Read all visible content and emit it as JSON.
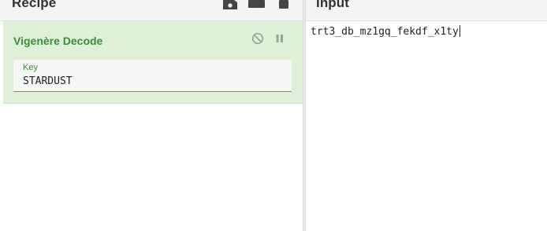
{
  "recipe": {
    "title": "Recipe",
    "toolbar_icons": [
      "save-icon",
      "folder-icon",
      "delete-icon"
    ],
    "operations": [
      {
        "name": "Vigenère Decode",
        "controls": [
          "disable-icon",
          "pause-icon"
        ],
        "fields": [
          {
            "label": "Key",
            "value": "STARDUST"
          }
        ]
      }
    ]
  },
  "input": {
    "title": "Input",
    "text": "trt3_db_mz1gq_fekdf_x1ty"
  },
  "colors": {
    "operation_background": "#dff0d8",
    "operation_title": "#3c8b3c",
    "header_background": "#f4f4f4"
  }
}
